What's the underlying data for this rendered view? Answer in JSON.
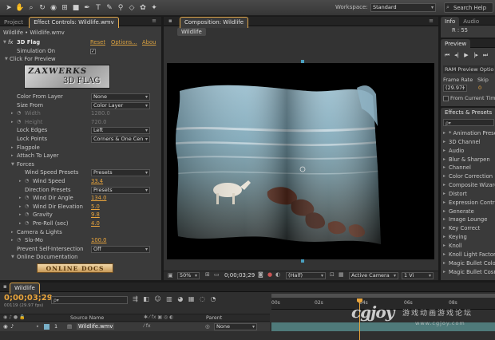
{
  "toolbar": {
    "workspace_label": "Workspace:",
    "workspace_value": "Standard",
    "search_placeholder": "Search Help"
  },
  "left_panel": {
    "tabs": [
      "Project",
      "Effect Controls: Wildlife.wmv"
    ],
    "breadcrumb": "Wildlife • Wildlife.wmv",
    "effect_name": "3D Flag",
    "reset": "Reset",
    "options": "Options...",
    "about": "Abou",
    "simulation_on": "Simulation On",
    "click_for_preview": "Click For Preview",
    "logo_line1": "ZAXWERKS",
    "logo_line2": "3D FLAG",
    "properties": [
      {
        "label": "Color From Layer",
        "value": "None",
        "type": "drop"
      },
      {
        "label": "Size From",
        "value": "Color Layer",
        "type": "drop"
      },
      {
        "label": "Width",
        "value": "1280.0",
        "type": "gray"
      },
      {
        "label": "Height",
        "value": "720.0",
        "type": "gray"
      },
      {
        "label": "Lock Edges",
        "value": "Left",
        "type": "drop"
      },
      {
        "label": "Lock Points",
        "value": "Corners & One Cen",
        "type": "drop"
      }
    ],
    "groups": [
      "Flagpole",
      "Attach To Layer",
      "Forces"
    ],
    "forces": [
      {
        "label": "Wind Speed Presets",
        "value": "Presets",
        "type": "drop"
      },
      {
        "label": "Wind Speed",
        "value": "33.4",
        "type": "num"
      },
      {
        "label": "Direction Presets",
        "value": "Presets",
        "type": "drop"
      },
      {
        "label": "Wind Dir Angle",
        "value": "134.0",
        "type": "num"
      },
      {
        "label": "Wind Dir Elevation",
        "value": "5.0",
        "type": "num"
      },
      {
        "label": "Gravity",
        "value": "9.8",
        "type": "num"
      },
      {
        "label": "Pre-Roll (sec)",
        "value": "4.0",
        "type": "num"
      }
    ],
    "camera_lights": "Camera & Lights",
    "slo_mo_label": "Slo-Mo",
    "slo_mo_value": "100.0",
    "prevent_label": "Prevent Self-Intersection",
    "prevent_value": "Off",
    "online_doc": "Online Documentation",
    "online_docs_button": "ONLINE DOCS"
  },
  "composition": {
    "tab": "Composition: Wildlife",
    "sub_tab": "Wildlife",
    "zoom": "50%",
    "timecode": "0;00;03;29",
    "resolution": "(Half)",
    "camera": "Active Camera",
    "views": "1 Vi"
  },
  "right_panel": {
    "info_tabs": [
      "Info",
      "Audio"
    ],
    "info_r": "R : 55",
    "preview_title": "Preview",
    "ram_options": "RAM Preview Optio",
    "frame_rate_label": "Frame Rate",
    "skip_label": "Skip",
    "frame_rate_value": "(29.97)",
    "skip_value": "0",
    "from_current": "From Current Tim",
    "effects_title": "Effects & Presets",
    "search_placeholder": "ρ▾",
    "categories": [
      "* Animation Prese",
      "3D Channel",
      "Audio",
      "Blur & Sharpen",
      "Channel",
      "Color Correction",
      "Composite Wizard",
      "Distort",
      "Expression Contro",
      "Generate",
      "Image Lounge",
      "Key Correct",
      "Keying",
      "Knoll",
      "Knoll Light Factory",
      "Magic Bullet Colori",
      "Magic Bullet Cosm"
    ]
  },
  "timeline": {
    "tab": "Wildlife",
    "timecode": "0;00;03;29",
    "frames": "00119 (29.97 fps)",
    "col_source": "Source Name",
    "col_parent": "Parent",
    "layer_num": "1",
    "layer_name": "Wildlife.wmv",
    "parent_value": "None",
    "ruler": [
      "00s",
      "02s",
      "04s",
      "06s",
      "08s"
    ]
  },
  "watermark": {
    "brand": "CGJOY",
    "tagline": "游戏动画游戏论坛",
    "url": "www.cgjoy.com"
  },
  "colors": {
    "accent_orange": "#e8a43c",
    "timeline_bar": "#4f7a7a",
    "panel_bg": "#3a3a3a"
  }
}
